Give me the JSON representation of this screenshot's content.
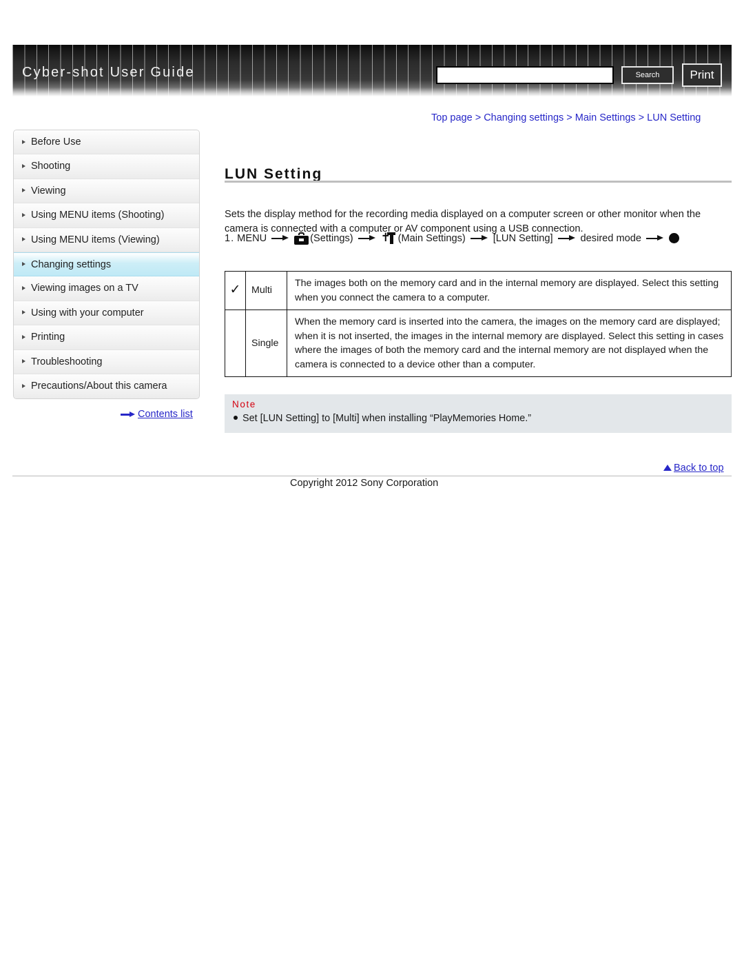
{
  "header": {
    "title": "Cyber-shot User Guide",
    "search_value": "",
    "search_placeholder": "",
    "search_button": "Search",
    "print_button": "Print"
  },
  "sidebar": {
    "items": [
      {
        "label": "Before Use",
        "selected": false
      },
      {
        "label": "Shooting",
        "selected": false
      },
      {
        "label": "Viewing",
        "selected": false
      },
      {
        "label": "Using MENU items (Shooting)",
        "selected": false
      },
      {
        "label": "Using MENU items (Viewing)",
        "selected": false
      },
      {
        "label": "Changing settings",
        "selected": true
      },
      {
        "label": "Viewing images on a TV",
        "selected": false
      },
      {
        "label": "Using with your computer",
        "selected": false
      },
      {
        "label": "Printing",
        "selected": false
      },
      {
        "label": "Troubleshooting",
        "selected": false
      },
      {
        "label": "Precautions/About this camera",
        "selected": false
      }
    ],
    "contents_list_label": "Contents list"
  },
  "breadcrumb": {
    "text": "Top page > Changing settings > Main Settings > LUN Setting",
    "parts": [
      "Top page",
      "Changing settings",
      "Main Settings",
      "LUN Setting"
    ],
    "separator": ">"
  },
  "main": {
    "title": "LUN Setting",
    "intro": "Sets the display method for the recording media displayed on a computer screen or other monitor when the camera is connected with a computer or AV component using a USB connection.",
    "step": {
      "number": "1.",
      "menu_label": "MENU",
      "settings_label": "(Settings)",
      "main_settings_label": "(Main Settings)",
      "lun_setting_label": "[LUN Setting]",
      "desired_mode_label": "desired mode",
      "settings_icon": "toolbox-icon",
      "main_settings_icon": "tools-icon",
      "end_icon": "filled-circle-icon"
    },
    "table": {
      "rows": [
        {
          "checked": true,
          "check_icon": "check-icon",
          "check_glyph": "✓",
          "name": "Multi",
          "description": "The images both on the memory card and in the internal memory are displayed. Select this setting when you connect the camera to a computer."
        },
        {
          "checked": false,
          "check_icon": "",
          "check_glyph": "",
          "name": "Single",
          "description": "When the memory card is inserted into the camera, the images on the memory card are displayed; when it is not inserted, the images in the internal memory are displayed. Select this setting in cases where the images of both the memory card and the internal memory are not displayed when the camera is connected to a device other than a computer."
        }
      ]
    },
    "note": {
      "label": "Note",
      "items": [
        "Set [LUN Setting] to [Multi] when installing “PlayMemories Home.”"
      ]
    }
  },
  "footer": {
    "back_to_top": "Back to top",
    "copyright": "Copyright 2012 Sony Corporation"
  },
  "colors": {
    "link": "#2727c8",
    "note_label": "#d4000f",
    "note_background": "#e3e7ea",
    "selected_sidebar": "#bfe9f6",
    "header_dark": "#2b2b2b"
  }
}
